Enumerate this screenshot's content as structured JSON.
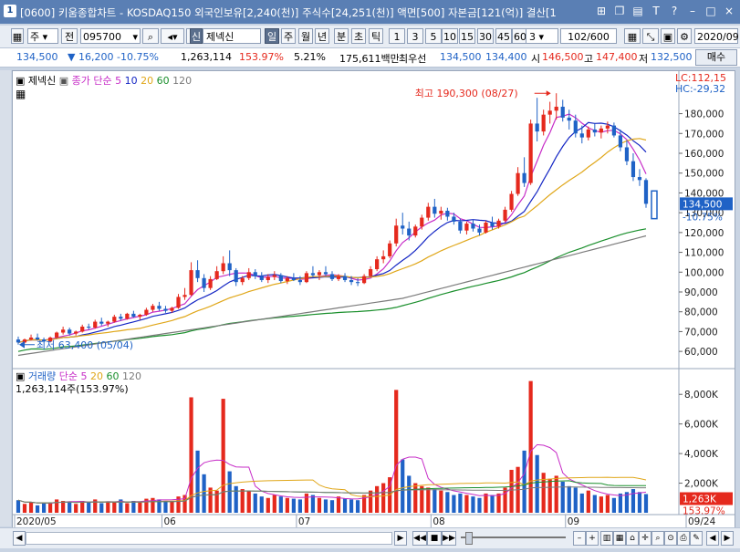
{
  "window": {
    "number": "1",
    "title": "[0600] 키움종합차트 - KOSDAQ150 외국인보유[2,240(천)] 주식수[24,251(천)] 액면[500] 자본금[121(억)] 결산[1"
  },
  "toolbar": {
    "market": "주",
    "prev": "전",
    "code": "095700",
    "name_tag": "신",
    "name": "제넥신",
    "periods": [
      "일",
      "주",
      "월",
      "년",
      "분",
      "초",
      "틱"
    ],
    "numbers": [
      "1",
      "3",
      "5",
      "10",
      "15",
      "30",
      "45",
      "60"
    ],
    "interval": "3",
    "count": "102/600",
    "date": "2020/09"
  },
  "quote": {
    "price": "134,500",
    "change": "16,200",
    "rate": "-10.75%",
    "volume": "1,263,114",
    "vol_rate": "153.97%",
    "turnover": "5.21%",
    "amount": "175,611백만",
    "sell_label": "최우선",
    "bid1": "134,500",
    "bid2": "134,400",
    "open_label": "시",
    "open": "146,500",
    "high_label": "고",
    "high": "147,400",
    "low_label": "저",
    "low": "132,500",
    "buy_button": "매수"
  },
  "legend": {
    "stock": "제넥신",
    "ma_prefix": "종가 단순",
    "ma": [
      "5",
      "10",
      "20",
      "60",
      "120"
    ],
    "lc": "LC:112,15",
    "hc": "HC:-29,32",
    "vol_prefix": "거래량",
    "vol_type": "단순",
    "vol_info": "1,263,114주(153.97%)"
  },
  "annotations": {
    "max": "최고 190,300 (08/27)",
    "min": "최저 63,400 (05/04)",
    "last_price": "134,500",
    "last_rate": "-10.75%",
    "last_vol": "1,263K",
    "last_vol_rate": "153.97%"
  },
  "colors": {
    "up": "#e5291d",
    "down": "#1f62c6",
    "ma5": "#c72dc7",
    "ma10": "#1426c4",
    "ma20": "#e0a71a",
    "ma60": "#1a8f2c",
    "ma120": "#7b7b7b"
  },
  "chart_data": {
    "type": "candlestick",
    "price_axis": [
      "180,000",
      "170,000",
      "160,000",
      "150,000",
      "140,000",
      "130,000",
      "120,000",
      "110,000",
      "100,000",
      "90,000",
      "80,000",
      "70,000",
      "60,000"
    ],
    "vol_axis": [
      "8,000K",
      "6,000K",
      "4,000K",
      "2,000K"
    ],
    "x_labels": [
      "2020/05",
      "06",
      "07",
      "08",
      "09",
      "09/24"
    ],
    "ylim": [
      55000,
      195000
    ],
    "vol_ylim": [
      0,
      9000
    ],
    "candles": [
      [
        66000,
        67500,
        63400,
        64500
      ],
      [
        64500,
        66500,
        64000,
        66000
      ],
      [
        66000,
        68500,
        65500,
        67000
      ],
      [
        67000,
        69000,
        65500,
        66000
      ],
      [
        66000,
        67000,
        64500,
        65000
      ],
      [
        65000,
        67500,
        64500,
        67000
      ],
      [
        67000,
        70000,
        66500,
        69500
      ],
      [
        69500,
        72500,
        68500,
        71000
      ],
      [
        71000,
        72000,
        68000,
        69000
      ],
      [
        69000,
        70500,
        68000,
        70000
      ],
      [
        70000,
        73500,
        69500,
        72500
      ],
      [
        72500,
        74000,
        71000,
        72000
      ],
      [
        72000,
        76000,
        71500,
        75000
      ],
      [
        75000,
        77000,
        73000,
        74000
      ],
      [
        74000,
        75500,
        72500,
        75000
      ],
      [
        75000,
        78500,
        74500,
        77500
      ],
      [
        77500,
        79000,
        75500,
        76500
      ],
      [
        76500,
        79500,
        76000,
        79000
      ],
      [
        79000,
        80500,
        77000,
        77500
      ],
      [
        77500,
        79000,
        76000,
        78500
      ],
      [
        78500,
        82000,
        78000,
        81000
      ],
      [
        81000,
        84000,
        80000,
        83000
      ],
      [
        83000,
        85000,
        80500,
        81500
      ],
      [
        81500,
        83000,
        79500,
        80500
      ],
      [
        80500,
        82500,
        79500,
        82000
      ],
      [
        82000,
        89000,
        81500,
        87500
      ],
      [
        87500,
        92000,
        86000,
        88500
      ],
      [
        88500,
        105000,
        88000,
        101000
      ],
      [
        101000,
        106000,
        95000,
        97000
      ],
      [
        97000,
        99000,
        90000,
        92000
      ],
      [
        92000,
        98000,
        91000,
        96500
      ],
      [
        96500,
        103000,
        96000,
        100500
      ],
      [
        100500,
        108000,
        99000,
        104500
      ],
      [
        104500,
        111000,
        98000,
        101000
      ],
      [
        101000,
        102000,
        93000,
        95000
      ],
      [
        95000,
        98000,
        93500,
        97000
      ],
      [
        97000,
        102000,
        96000,
        100000
      ],
      [
        100000,
        101500,
        96500,
        98000
      ],
      [
        98000,
        100000,
        95000,
        96000
      ],
      [
        96000,
        99000,
        94500,
        97500
      ],
      [
        97500,
        100500,
        96000,
        98500
      ],
      [
        98500,
        99500,
        94500,
        95500
      ],
      [
        95500,
        98000,
        94000,
        97000
      ],
      [
        97000,
        99500,
        95500,
        96000
      ],
      [
        96000,
        98000,
        93500,
        95000
      ],
      [
        95000,
        100500,
        94500,
        99500
      ],
      [
        99500,
        103000,
        97500,
        98500
      ],
      [
        98500,
        101000,
        96000,
        100000
      ],
      [
        100000,
        103000,
        98000,
        99000
      ],
      [
        99000,
        100500,
        95500,
        96500
      ],
      [
        96500,
        99000,
        95500,
        98000
      ],
      [
        98000,
        99500,
        95000,
        96000
      ],
      [
        96000,
        98000,
        93500,
        95000
      ],
      [
        95000,
        97000,
        93000,
        94500
      ],
      [
        94500,
        99000,
        94000,
        98000
      ],
      [
        98000,
        103000,
        97500,
        101500
      ],
      [
        101500,
        108000,
        100500,
        106500
      ],
      [
        106500,
        111000,
        104500,
        108000
      ],
      [
        108000,
        116000,
        107000,
        114500
      ],
      [
        114500,
        127000,
        113000,
        123500
      ],
      [
        123500,
        130000,
        119000,
        122000
      ],
      [
        122000,
        125500,
        116000,
        118500
      ],
      [
        118500,
        124000,
        117500,
        123000
      ],
      [
        123000,
        129000,
        121500,
        127500
      ],
      [
        127500,
        135000,
        126000,
        133000
      ],
      [
        133000,
        137000,
        127500,
        129500
      ],
      [
        129500,
        133000,
        126500,
        131000
      ],
      [
        131000,
        132500,
        126000,
        128000
      ],
      [
        128000,
        130000,
        124000,
        125500
      ],
      [
        125500,
        127000,
        119500,
        121000
      ],
      [
        121000,
        125500,
        119000,
        124500
      ],
      [
        124500,
        126500,
        120500,
        122000
      ],
      [
        122000,
        124000,
        118500,
        120000
      ],
      [
        120000,
        126000,
        119500,
        125000
      ],
      [
        125000,
        128000,
        121500,
        123000
      ],
      [
        123000,
        127000,
        122000,
        126000
      ],
      [
        126000,
        133000,
        125500,
        131500
      ],
      [
        131500,
        141000,
        130500,
        139500
      ],
      [
        139500,
        153000,
        138500,
        150000
      ],
      [
        150000,
        158000,
        143000,
        145000
      ],
      [
        145000,
        177000,
        144000,
        175000
      ],
      [
        175000,
        188000,
        166000,
        171000
      ],
      [
        171000,
        182000,
        169000,
        179500
      ],
      [
        179500,
        186000,
        175000,
        181500
      ],
      [
        181500,
        190300,
        177000,
        183500
      ],
      [
        183500,
        187000,
        176000,
        178000
      ],
      [
        178000,
        182000,
        172000,
        176500
      ],
      [
        176500,
        179500,
        168000,
        170000
      ],
      [
        170000,
        174000,
        165000,
        168000
      ],
      [
        168000,
        173500,
        166500,
        172000
      ],
      [
        172000,
        175000,
        168500,
        170500
      ],
      [
        170500,
        174000,
        167500,
        172500
      ],
      [
        172500,
        176000,
        170000,
        174000
      ],
      [
        174000,
        175500,
        168000,
        169000
      ],
      [
        169000,
        172000,
        161000,
        163000
      ],
      [
        163000,
        166500,
        154000,
        156000
      ],
      [
        156000,
        160000,
        146000,
        148000
      ],
      [
        148000,
        152000,
        143500,
        146500
      ],
      [
        146500,
        147400,
        132500,
        134500
      ]
    ],
    "volumes": [
      850,
      600,
      700,
      500,
      650,
      700,
      900,
      800,
      750,
      600,
      800,
      700,
      900,
      650,
      700,
      750,
      900,
      650,
      800,
      700,
      950,
      1000,
      900,
      800,
      750,
      1100,
      1200,
      7800,
      4200,
      2600,
      1700,
      1500,
      7700,
      2800,
      1800,
      1600,
      1500,
      1300,
      1100,
      1000,
      1200,
      1100,
      1000,
      950,
      900,
      1300,
      1200,
      1000,
      900,
      850,
      1100,
      950,
      900,
      850,
      1200,
      1500,
      1800,
      2000,
      2400,
      8300,
      3600,
      2500,
      2000,
      1800,
      1700,
      1600,
      1500,
      1400,
      1200,
      1300,
      1200,
      1100,
      1000,
      1300,
      1200,
      1300,
      1700,
      2900,
      3100,
      4200,
      8900,
      3900,
      2700,
      2300,
      2500,
      2100,
      1800,
      1700,
      1300,
      1500,
      1200,
      1100,
      1200,
      1000,
      1300,
      1400,
      1600,
      1400,
      1263
    ],
    "series": [
      {
        "name": "5",
        "color": "#c72dc7"
      },
      {
        "name": "10",
        "color": "#1426c4"
      },
      {
        "name": "20",
        "color": "#e0a71a"
      },
      {
        "name": "60",
        "color": "#1a8f2c"
      },
      {
        "name": "120",
        "color": "#7b7b7b"
      }
    ],
    "max": {
      "value": 190300,
      "date": "08/27"
    },
    "min": {
      "value": 63400,
      "date": "05/04"
    }
  }
}
